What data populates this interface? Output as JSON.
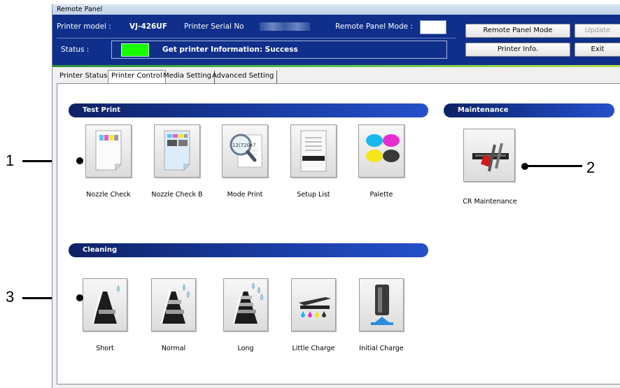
{
  "window": {
    "title": "Remote Panel"
  },
  "header": {
    "printer_model_label": "Printer model :",
    "printer_model_value": "VJ-426UF",
    "serial_label": "Printer Serial No",
    "remote_mode_label": "Remote Panel Mode :",
    "status_label": "Status :",
    "status_message": "Get printer Information: Success",
    "status_color": "#18ff00",
    "buttons": {
      "remote_panel_mode": "Remote Panel Mode",
      "update": "Update",
      "printer_info": "Printer Info.",
      "exit": "Exit"
    }
  },
  "tabs": [
    {
      "label": "Printer Status"
    },
    {
      "label": "Printer Control",
      "active": true
    },
    {
      "label": "Media Setting"
    },
    {
      "label": "Advanced Setting"
    }
  ],
  "sections": {
    "test_print": {
      "title": "Test Print",
      "items": [
        {
          "label": "Nozzle Check",
          "icon": "nozzle-check-icon"
        },
        {
          "label": "Nozzle Check B",
          "icon": "nozzle-check-b-icon"
        },
        {
          "label": "Mode Print",
          "icon": "mode-print-icon",
          "icon_text": "12(720x7"
        },
        {
          "label": "Setup List",
          "icon": "setup-list-icon"
        },
        {
          "label": "Palette",
          "icon": "palette-icon"
        }
      ]
    },
    "maintenance": {
      "title": "Maintenance",
      "items": [
        {
          "label": "CR Maintenance",
          "icon": "cr-maintenance-icon"
        }
      ]
    },
    "cleaning": {
      "title": "Cleaning",
      "items": [
        {
          "label": "Short",
          "icon": "cleaning-short-icon"
        },
        {
          "label": "Normal",
          "icon": "cleaning-normal-icon"
        },
        {
          "label": "Long",
          "icon": "cleaning-long-icon"
        },
        {
          "label": "Little Charge",
          "icon": "little-charge-icon"
        },
        {
          "label": "Initial Charge",
          "icon": "initial-charge-icon"
        }
      ]
    }
  },
  "callouts": [
    {
      "label": "1"
    },
    {
      "label": "2"
    },
    {
      "label": "3"
    }
  ],
  "colors": {
    "header_bg": "#0f2f8a",
    "section_bg": "#1a3ea6",
    "accent_green": "#5bc24a"
  }
}
